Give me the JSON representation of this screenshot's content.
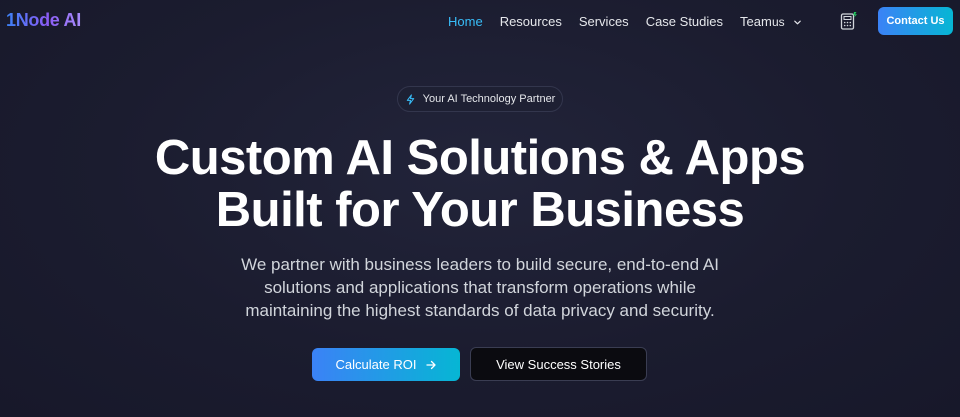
{
  "nav": {
    "logo": "1Node AI",
    "links": [
      {
        "label": "Home",
        "active": true
      },
      {
        "label": "Resources",
        "active": false
      },
      {
        "label": "Services",
        "active": false
      },
      {
        "label": "Case Studies",
        "active": false
      },
      {
        "label": "Team",
        "active": false
      }
    ],
    "language": "us",
    "calculator_icon": "calculator-icon",
    "contact_label": "Contact Us"
  },
  "hero": {
    "badge": "Your AI Technology Partner",
    "badge_icon": "lightning-icon",
    "headline_line1": "Custom AI Solutions & Apps",
    "headline_line2": "Built for Your Business",
    "subtext_line1": "We partner with business leaders to build secure, end-to-end AI",
    "subtext_line2": "solutions and applications that transform operations while",
    "subtext_line3": "maintaining the highest standards of data privacy and security.",
    "primary_cta": "Calculate ROI",
    "primary_cta_icon": "arrow-right-icon",
    "secondary_cta": "View Success Stories"
  },
  "colors": {
    "background": "#1a1b2e",
    "accent_blue": "#3b82f6",
    "accent_cyan": "#06b6d4",
    "active_link": "#38bdf8"
  }
}
